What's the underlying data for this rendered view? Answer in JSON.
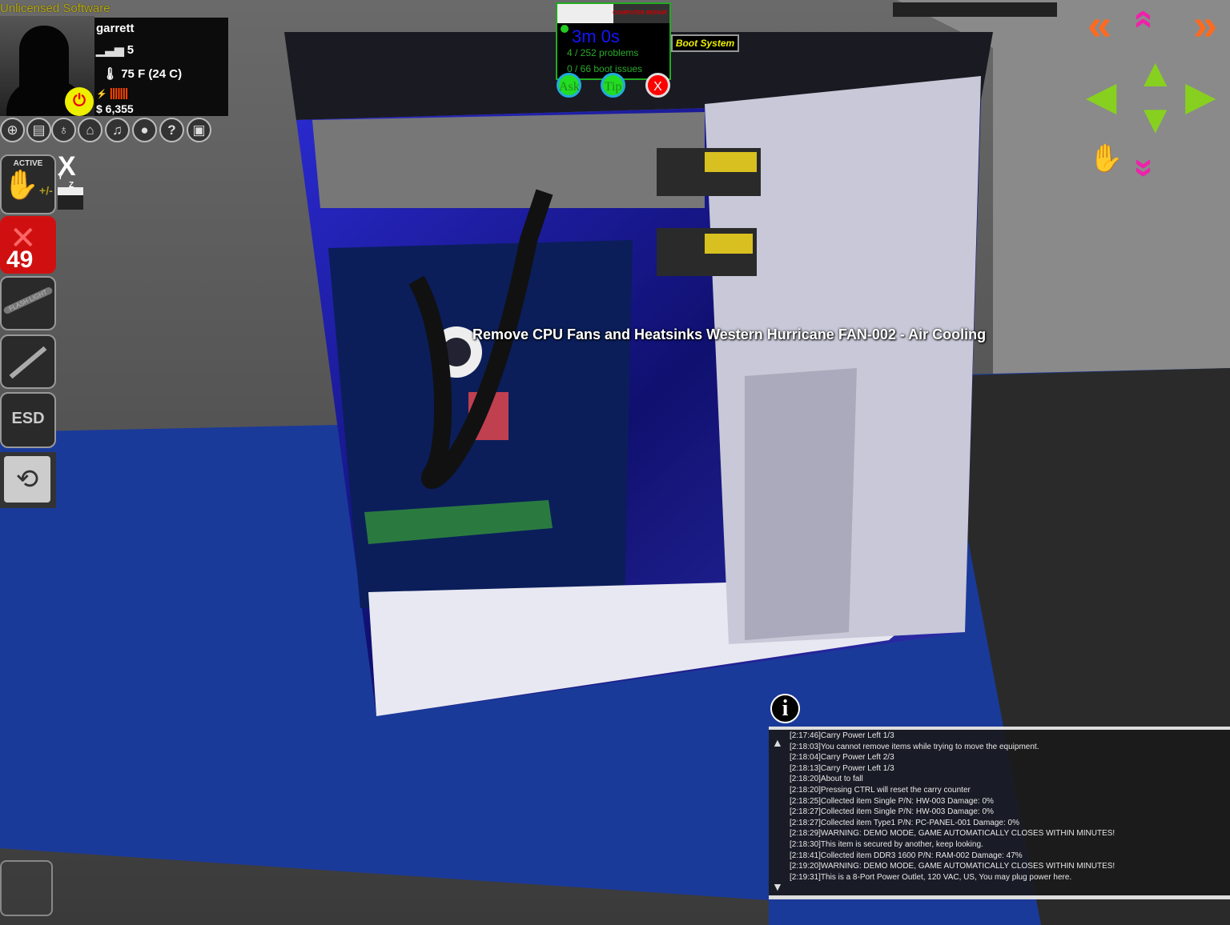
{
  "watermark": "Unlicensed Software",
  "player": {
    "name": "garrett",
    "level": "5",
    "temperature": "75 F (24 C)",
    "money": "$ 6,355",
    "power_bars": 7
  },
  "hud_icons": [
    "target-icon",
    "manual-icon",
    "lightbulb-icon",
    "shop-icon",
    "music-icon",
    "record-icon",
    "help-icon",
    "save-icon"
  ],
  "tools": {
    "active_label": "ACTIVE",
    "active_suffix": "+/-",
    "hand_count": "49",
    "flashlight_label": "FLASH LIGHT",
    "esd_label": "ESD"
  },
  "axis_toggle": {
    "x": "X",
    "y": "Y",
    "z": "Z"
  },
  "status": {
    "timer": "3m 0s",
    "problems": "4 / 252 problems",
    "boot_issues": "0 / 66 boot issues",
    "ask": "Ask",
    "tip": "Tip",
    "close": "X",
    "boot_button": "Boot System",
    "logo_text": "COMPUTER REPAIR"
  },
  "tooltip": "Remove  CPU Fans and Heatsinks Western Hurricane FAN-002 - Air Cooling",
  "colors": {
    "orange_arrow": "#ff6a20",
    "pink_arrow": "#ee22aa",
    "green_arrow": "#88d020",
    "timer": "#1515ff",
    "counter": "#2aaa2a"
  },
  "log": [
    "[2:17:46]Carry Power Left 1/3",
    "[2:18:03]You cannot remove items while trying to move the equipment.",
    "[2:18:04]Carry Power Left 2/3",
    "[2:18:13]Carry Power Left 1/3",
    "[2:18:20]About to fall",
    "[2:18:20]Pressing CTRL will reset the carry counter",
    "[2:18:25]Collected item  Single P/N: HW-003 Damage: 0%",
    "[2:18:27]Collected item  Single P/N: HW-003 Damage: 0%",
    "[2:18:27]Collected item  Type1 P/N: PC-PANEL-001 Damage: 0%",
    "[2:18:29]WARNING:  DEMO MODE, GAME AUTOMATICALLY CLOSES WITHIN MINUTES!",
    "[2:18:30]This item is secured by another, keep looking.",
    "[2:18:41]Collected item  DDR3 1600 P/N: RAM-002 Damage: 47%",
    "[2:19:20]WARNING:  DEMO MODE, GAME AUTOMATICALLY CLOSES WITHIN MINUTES!",
    "[2:19:31]This is a 8-Port Power Outlet, 120 VAC,  US,  You may plug power here."
  ]
}
